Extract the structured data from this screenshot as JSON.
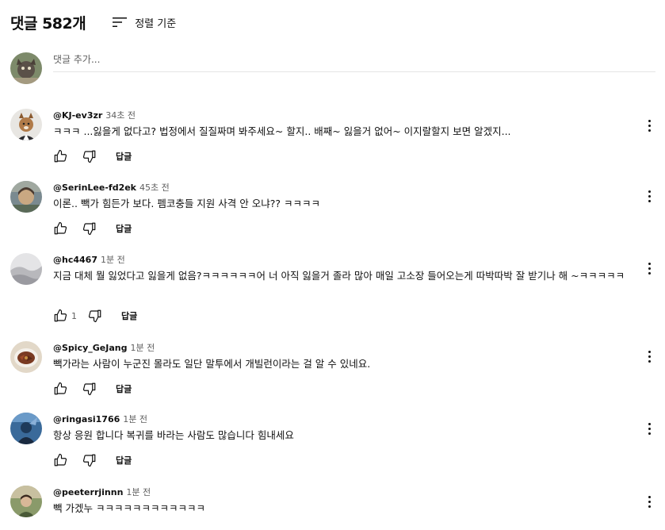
{
  "header": {
    "title": "댓글 582개",
    "sort_label": "정렬 기준"
  },
  "add_comment": {
    "placeholder": "댓글 추가..."
  },
  "reply_label": "답글",
  "comments": [
    {
      "author": "@KJ-ev3zr",
      "time": "34초 전",
      "text": "ㅋㅋㅋ ...잃을게 없다고? 법정에서 질질짜며 봐주세요~ 할지.. 배째~ 잃을거 없어~ 이지랄할지 보면 알겠지...",
      "likes": ""
    },
    {
      "author": "@SerinLee-fd2ek",
      "time": "45초 전",
      "text": "이론.. 빽가 힘든가 보다. 펨코충들 지원 사격 안 오냐?? ㅋㅋㅋㅋ",
      "likes": ""
    },
    {
      "author": "@hc4467",
      "time": "1분 전",
      "text": "지금 대체 뭘 잃었다고 잃을게 없음?ㅋㅋㅋㅋㅋㅋ어 너 아직 잃을거 졸라 많아 매일 고소장 들어오는게 따박따박 잘 받기나 해 ~ㅋㅋㅋㅋㅋ",
      "likes": "1"
    },
    {
      "author": "@Spicy_GeJang",
      "time": "1분 전",
      "text": "빽가라는 사람이 누군진 몰라도 일단 말투에서 개빌런이라는 걸 알 수 있네요.",
      "likes": ""
    },
    {
      "author": "@ringasi1766",
      "time": "1분 전",
      "text": "항상 응원 합니다 복귀를 바라는 사람도 많습니다 힘내세요",
      "likes": ""
    },
    {
      "author": "@peeterrjinnn",
      "time": "1분 전",
      "text": "빽 가겠누 ㅋㅋㅋㅋㅋㅋㅋㅋㅋㅋㅋㅋ",
      "likes": ""
    }
  ],
  "icons": {
    "sort": "sort-icon",
    "like": "thumbs-up-icon",
    "dislike": "thumbs-down-icon",
    "more": "more-vert-icon"
  },
  "colors": {
    "text": "#0f0f0f",
    "secondary_text": "#606060",
    "divider": "#e5e5e5"
  }
}
